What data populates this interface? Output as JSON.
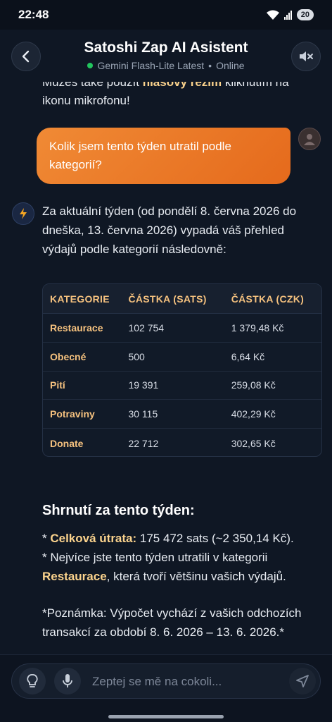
{
  "status": {
    "time": "22:48",
    "battery": "20"
  },
  "header": {
    "title": "Satoshi Zap AI Asistent",
    "model": "Gemini Flash-Lite Latest",
    "separator": "•",
    "presence": "Online"
  },
  "chat": {
    "clipped_prev": {
      "before": "Můžeš také použít ",
      "highlight": "hlasový režim",
      "after": " kliknutím na ikonu mikrofonu!"
    },
    "user_message": "Kolik jsem tento týden utratil podle kategorií?",
    "ai_intro": "Za aktuální týden (od pondělí 8. června 2026 do dneška, 13. června 2026) vypadá váš přehled výdajů podle kategorií následovně:",
    "table": {
      "headers": [
        "KATEGORIE",
        "ČÁSTKA (SATS)",
        "ČÁSTKA (CZK)"
      ],
      "rows": [
        [
          "Restaurace",
          "102 754",
          "1 379,48 Kč"
        ],
        [
          "Obecné",
          "500",
          "6,64 Kč"
        ],
        [
          "Pití",
          "19 391",
          "259,08 Kč"
        ],
        [
          "Potraviny",
          "30 115",
          "402,29 Kč"
        ],
        [
          "Donate",
          "22 712",
          "302,65 Kč"
        ]
      ]
    },
    "summary_title": "Shrnutí za tento týden:",
    "summary_line1": {
      "prefix": "* ",
      "label": "Celková útrata:",
      "text": " 175 472 sats (~2 350,14 Kč)."
    },
    "summary_line2": {
      "prefix": "* Nejvíce jste tento týden utratili v kategorii ",
      "label": "Restaurace",
      "text": ", která tvoří většinu vašich výdajů."
    },
    "note": "*Poznámka: Výpočet vychází z vašich odchozích transakcí za období 8. 6. 2026 – 13. 6. 2026.*"
  },
  "input": {
    "placeholder": "Zeptej se mě na cokoli..."
  },
  "colors": {
    "accent": "#e56a1c",
    "highlight": "#fbd38d",
    "online": "#22c55e"
  }
}
